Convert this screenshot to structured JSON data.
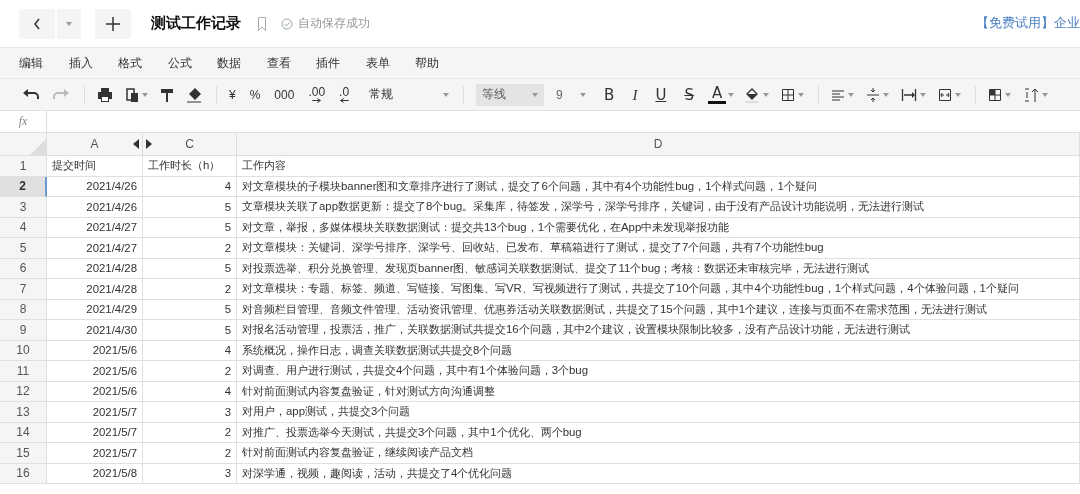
{
  "header": {
    "title": "测试工作记录",
    "save_status": "自动保存成功",
    "promo": "【免费试用】企业"
  },
  "menu": [
    "编辑",
    "插入",
    "格式",
    "公式",
    "数据",
    "查看",
    "插件",
    "表单",
    "帮助"
  ],
  "toolbar": {
    "format_buttons": [
      "¥",
      "%",
      "000",
      ".00",
      ".0"
    ],
    "number_format": "常规",
    "font": "等线",
    "font_size": "9",
    "style_buttons": [
      "B",
      "I",
      "U",
      "S",
      "A"
    ]
  },
  "formula_bar": {
    "label": "fx"
  },
  "columns": [
    "A",
    "C",
    "D"
  ],
  "rows": [
    {
      "number": "1",
      "kind": "header",
      "selected": false,
      "cells": [
        "提交时间",
        "工作时长（h）",
        "工作内容"
      ]
    },
    {
      "number": "2",
      "kind": "data",
      "selected": true,
      "cells": [
        "2021/4/26",
        "4",
        "对文章模块的子模块banner图和文章排序进行了测试，提交了6个问题，其中有4个功能性bug，1个样式问题，1个疑问"
      ]
    },
    {
      "number": "3",
      "kind": "data",
      "selected": false,
      "cells": [
        "2021/4/26",
        "5",
        "文章模块关联了app数据更新：提交了8个bug。采集库，待签发，深学号，深学号排序，关键词，由于没有产品设计功能说明，无法进行测试"
      ]
    },
    {
      "number": "4",
      "kind": "data",
      "selected": false,
      "cells": [
        "2021/4/27",
        "5",
        "对文章，举报，多媒体模块关联数据测试：提交共13个bug，1个需要优化，在App中未发现举报功能"
      ]
    },
    {
      "number": "5",
      "kind": "data",
      "selected": false,
      "cells": [
        "2021/4/27",
        "2",
        "对文章模块：关键词、深学号排序、深学号、回收站、已发布、草稿箱进行了测试，提交了7个问题，共有7个功能性bug"
      ]
    },
    {
      "number": "6",
      "kind": "data",
      "selected": false,
      "cells": [
        "2021/4/28",
        "5",
        "对投票选举、积分兑换管理、发现页banner图、敏感词关联数据测试、提交了11个bug；考核：数据还未审核完毕，无法进行测试"
      ]
    },
    {
      "number": "7",
      "kind": "data",
      "selected": false,
      "cells": [
        "2021/4/28",
        "2",
        "对文章模块：专题、标签、频道、写链接、写图集、写VR、写视频进行了测试，共提交了10个问题，其中4个功能性bug，1个样式问题，4个体验问题，1个疑问"
      ]
    },
    {
      "number": "8",
      "kind": "data",
      "selected": false,
      "cells": [
        "2021/4/29",
        "5",
        "对音频栏目管理、音频文件管理、活动资讯管理、优惠券活动关联数据测试，共提交了15个问题，其中1个建议，连接与页面不在需求范围，无法进行测试"
      ]
    },
    {
      "number": "9",
      "kind": "data",
      "selected": false,
      "cells": [
        "2021/4/30",
        "5",
        "对报名活动管理，投票活，推广，关联数据测试共提交16个问题，其中2个建议，设置模块限制比较多，没有产品设计功能，无法进行测试"
      ]
    },
    {
      "number": "10",
      "kind": "data",
      "selected": false,
      "cells": [
        "2021/5/6",
        "4",
        "系统概况，操作日志，调查关联数据测试共提交8个问题"
      ]
    },
    {
      "number": "11",
      "kind": "data",
      "selected": false,
      "cells": [
        "2021/5/6",
        "2",
        "对调查、用户进行测试，共提交4个问题，其中有1个体验问题，3个bug"
      ]
    },
    {
      "number": "12",
      "kind": "data",
      "selected": false,
      "cells": [
        "2021/5/6",
        "4",
        "针对前面测试内容复盘验证，针对测试方向沟通调整"
      ]
    },
    {
      "number": "13",
      "kind": "data",
      "selected": false,
      "cells": [
        "2021/5/7",
        "3",
        "对用户，app测试，共提交3个问题"
      ]
    },
    {
      "number": "14",
      "kind": "data",
      "selected": false,
      "cells": [
        "2021/5/7",
        "2",
        "对推广、投票选举今天测试，共提交3个问题，其中1个优化、两个bug"
      ]
    },
    {
      "number": "15",
      "kind": "data",
      "selected": false,
      "cells": [
        "2021/5/7",
        "2",
        "针对前面测试内容复盘验证，继续阅读产品文档"
      ]
    },
    {
      "number": "16",
      "kind": "data",
      "selected": false,
      "cells": [
        "2021/5/8",
        "3",
        "对深学通，视频，趣阅读，活动，共提交了4个优化问题"
      ]
    }
  ]
}
